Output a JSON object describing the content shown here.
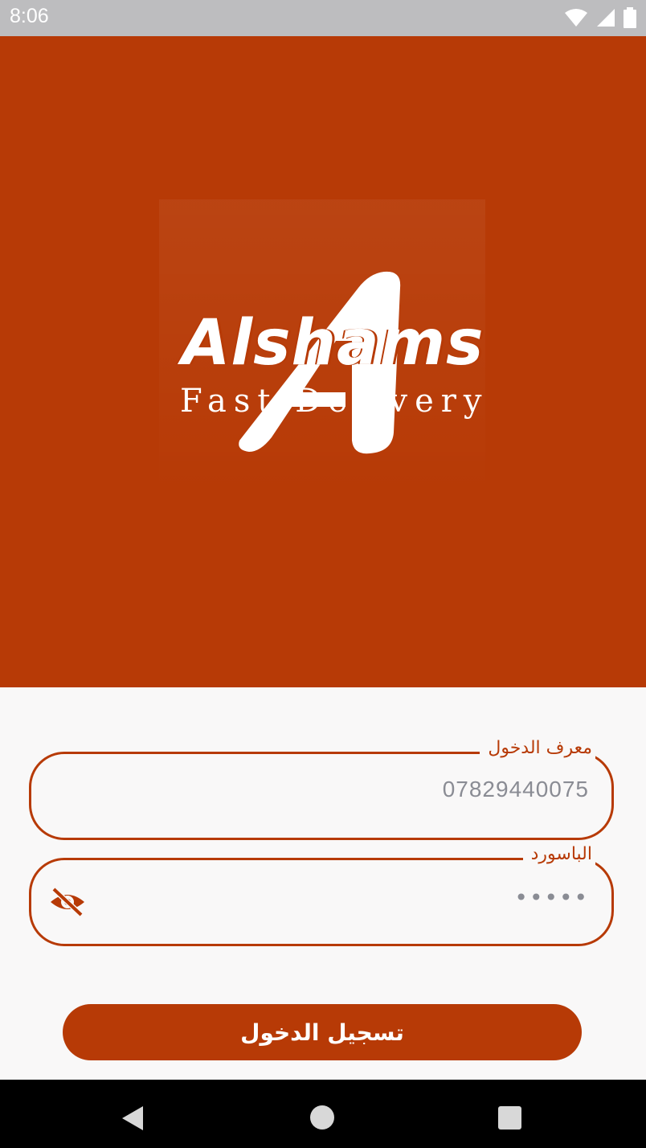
{
  "status_bar": {
    "time": "8:06",
    "icons": [
      "wifi-icon",
      "cellular-signal-icon",
      "battery-icon"
    ]
  },
  "header": {
    "background_color": "#B73A06",
    "logo": {
      "brand_name": "Alshams",
      "tagline": "Fast Delivery",
      "emblem_letter": "A"
    }
  },
  "form": {
    "login_id": {
      "label": "معرف الدخول",
      "value": "07829440075"
    },
    "password": {
      "label": "الباسورد",
      "masked_value": "•••••",
      "toggle_icon": "eye-off-icon"
    },
    "submit_label": "تسجيل الدخول"
  },
  "nav_bar": {
    "buttons": [
      "back-icon",
      "home-icon",
      "recents-icon"
    ]
  },
  "colors": {
    "accent": "#B73A06",
    "background": "#F9F8F8",
    "placeholder_text": "#8A8C94"
  }
}
